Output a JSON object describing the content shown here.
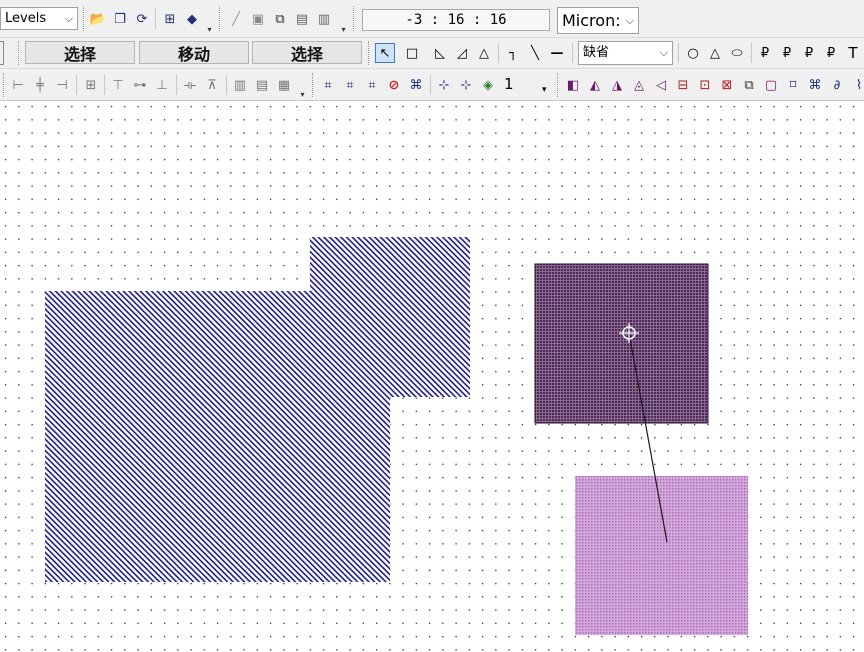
{
  "toolbar_top": {
    "levels_label": "Levels",
    "coordinate": "-3 : 16 : 16",
    "units_label": "Micron:",
    "combo_arrow": "⌵",
    "overflow_glyph": "▾"
  },
  "toolbar_mode": {
    "buttons": [
      "选择",
      "移动",
      "选择"
    ],
    "style_label": "缺省",
    "text_tool_label": "T"
  },
  "toolbar_align": {
    "layer_value": "1",
    "layer_arrow": "▾"
  },
  "icons": {
    "open": "📂",
    "copy": "❐",
    "refresh": "⟳",
    "layers-a": "⊞",
    "layers-b": "◆",
    "pen": "╱",
    "save": "▣",
    "stack": "⧉",
    "view-1": "▤",
    "view-2": "▥",
    "pointer": "↖",
    "rect": "□",
    "poly-1": "◺",
    "poly-2": "◿",
    "triangle": "△",
    "wire-1": "┐",
    "wire-2": "╲",
    "wire-3": "—",
    "circle": "○",
    "arc": "△",
    "ellipse": "⬭",
    "label-1": "₽",
    "label-2": "₽",
    "label-3": "₽",
    "label-4": "₽",
    "align-left": "⊢",
    "align-center": "╪",
    "align-right": "⊣",
    "distribute": "⊞",
    "align-top": "⊤",
    "align-mid": "⊶",
    "align-bottom": "⊥",
    "space-h": "⟛",
    "space-v": "⊼",
    "group-1": "▥",
    "group-2": "▤",
    "group-3": "▦",
    "select-all": "⌗",
    "select-area": "⌗",
    "select-edge": "⌗",
    "deny": "⊘",
    "merge": "⌘",
    "snap-1": "⊹",
    "snap-2": "⊹",
    "snap-3": "◈",
    "bool-1": "◧",
    "bool-2": "◭",
    "bool-3": "◮",
    "bool-4": "◬",
    "bool-5": "◁",
    "bool-6": "⊟",
    "bool-7": "⊡",
    "bool-8": "⊠",
    "bool-9": "⧉",
    "bool-10": "▢",
    "bool-11": "⌑",
    "bool-12": "⌘",
    "bool-13": "∂",
    "bool-14": "⌇"
  },
  "colors": {
    "toolbar_bg": "#f0f0f0",
    "canvas_bg": "#ffffff",
    "grid_dot": "#000000",
    "blue_shape_stroke": "#1c1c8a",
    "dark_square_fill": "#6b4a72",
    "dark_square_stroke": "#2a0f33",
    "pink_square_fill": "#c792d0",
    "pink_square_dark": "#9a62a6",
    "connector_line": "#1a1a1a"
  }
}
